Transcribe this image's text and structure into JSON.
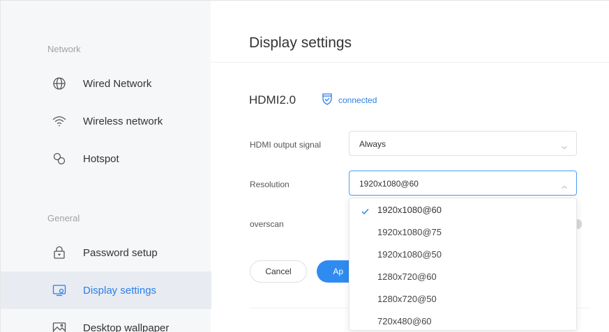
{
  "sidebar": {
    "sections": [
      {
        "label": "Network"
      },
      {
        "label": "General"
      }
    ],
    "items": [
      {
        "label": "Wired Network",
        "icon": "globe-icon"
      },
      {
        "label": "Wireless network",
        "icon": "wifi-icon"
      },
      {
        "label": "Hotspot",
        "icon": "hotspot-icon"
      },
      {
        "label": "Password setup",
        "icon": "lock-icon"
      },
      {
        "label": "Display settings",
        "icon": "display-icon",
        "active": true
      },
      {
        "label": "Desktop wallpaper",
        "icon": "image-icon"
      }
    ]
  },
  "main": {
    "title": "Display settings",
    "hdmi": {
      "name": "HDMI2.0",
      "status": "connected",
      "status_icon": "shield-check-icon"
    },
    "fields": {
      "output_signal": {
        "label": "HDMI output signal",
        "value": "Always"
      },
      "resolution": {
        "label": "Resolution",
        "value": "1920x1080@60"
      },
      "overscan": {
        "label": "overscan"
      }
    },
    "buttons": {
      "cancel": "Cancel",
      "apply": "Ap"
    },
    "resolution_options": [
      {
        "label": "1920x1080@60",
        "selected": true
      },
      {
        "label": "1920x1080@75"
      },
      {
        "label": "1920x1080@50"
      },
      {
        "label": "1280x720@60"
      },
      {
        "label": "1280x720@50"
      },
      {
        "label": "720x480@60"
      }
    ]
  },
  "colors": {
    "accent": "#2b7de9",
    "sidebar_bg": "#f6f7f9",
    "active_bg": "#e8ecf2"
  }
}
